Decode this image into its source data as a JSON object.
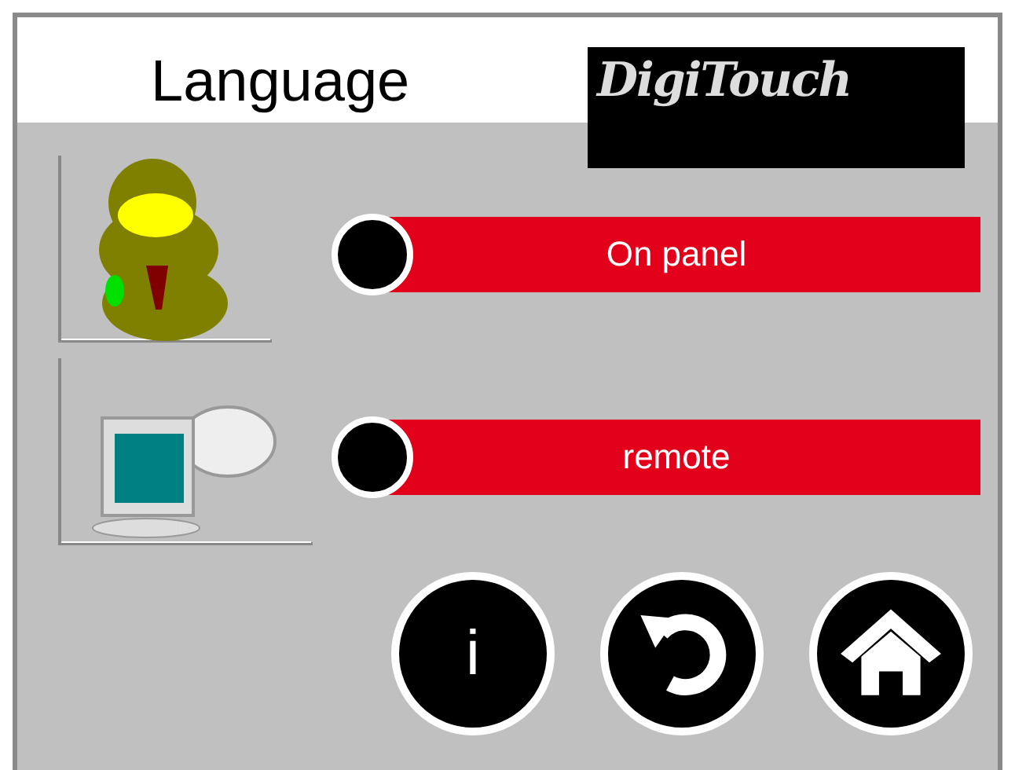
{
  "title": "Language",
  "logo": "DigiTouch",
  "options": [
    {
      "kind": "person",
      "label": "On panel",
      "on": false
    },
    {
      "kind": "remote",
      "label": "remote",
      "on": false
    }
  ],
  "buttons": [
    {
      "kind": "info",
      "label": "i"
    },
    {
      "kind": "back"
    },
    {
      "kind": "home"
    }
  ]
}
